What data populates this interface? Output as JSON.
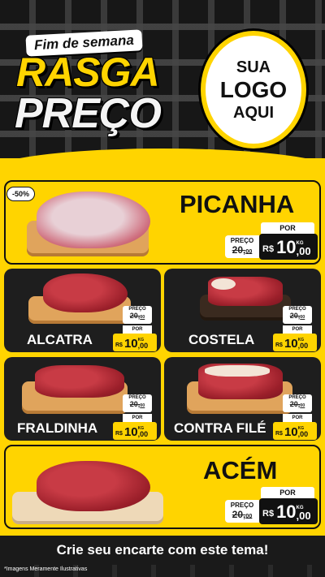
{
  "header": {
    "weekend": "Fim de semana",
    "line1": "RASGA",
    "line2": "PREÇO",
    "logo": {
      "line1": "SUA",
      "line2": "LOGO",
      "line3": "AQUI"
    }
  },
  "colors": {
    "accent": "#ffd400",
    "dark": "#1e1e1e",
    "text": "#111111"
  },
  "discount_badge": "-50%",
  "products": [
    {
      "name": "PICANHA",
      "preco_label": "PREÇO",
      "old_int": "20",
      "old_dec": "00",
      "por_label": "POR",
      "currency": "R$",
      "new_int": "10",
      "new_dec": "00",
      "unit": "KG"
    },
    {
      "name": "ALCATRA",
      "preco_label": "PREÇO",
      "old_int": "20",
      "old_dec": "00",
      "por_label": "POR",
      "currency": "R$",
      "new_int": "10",
      "new_dec": "00",
      "unit": "KG"
    },
    {
      "name": "COSTELA",
      "preco_label": "PREÇO",
      "old_int": "20",
      "old_dec": "00",
      "por_label": "POR",
      "currency": "R$",
      "new_int": "10",
      "new_dec": "00",
      "unit": "KG"
    },
    {
      "name": "FRALDINHA",
      "preco_label": "PREÇO",
      "old_int": "20",
      "old_dec": "00",
      "por_label": "POR",
      "currency": "R$",
      "new_int": "10",
      "new_dec": "00",
      "unit": "KG"
    },
    {
      "name": "CONTRA FILÉ",
      "preco_label": "PREÇO",
      "old_int": "20",
      "old_dec": "00",
      "por_label": "POR",
      "currency": "R$",
      "new_int": "10",
      "new_dec": "00",
      "unit": "KG"
    },
    {
      "name": "ACÉM",
      "preco_label": "PREÇO",
      "old_int": "20",
      "old_dec": "00",
      "por_label": "POR",
      "currency": "R$",
      "new_int": "10",
      "new_dec": "00",
      "unit": "KG"
    }
  ],
  "footer": {
    "cta": "Crie seu encarte com este tema!",
    "disclaimer": "*Imagens Meramente Ilustrativas"
  }
}
